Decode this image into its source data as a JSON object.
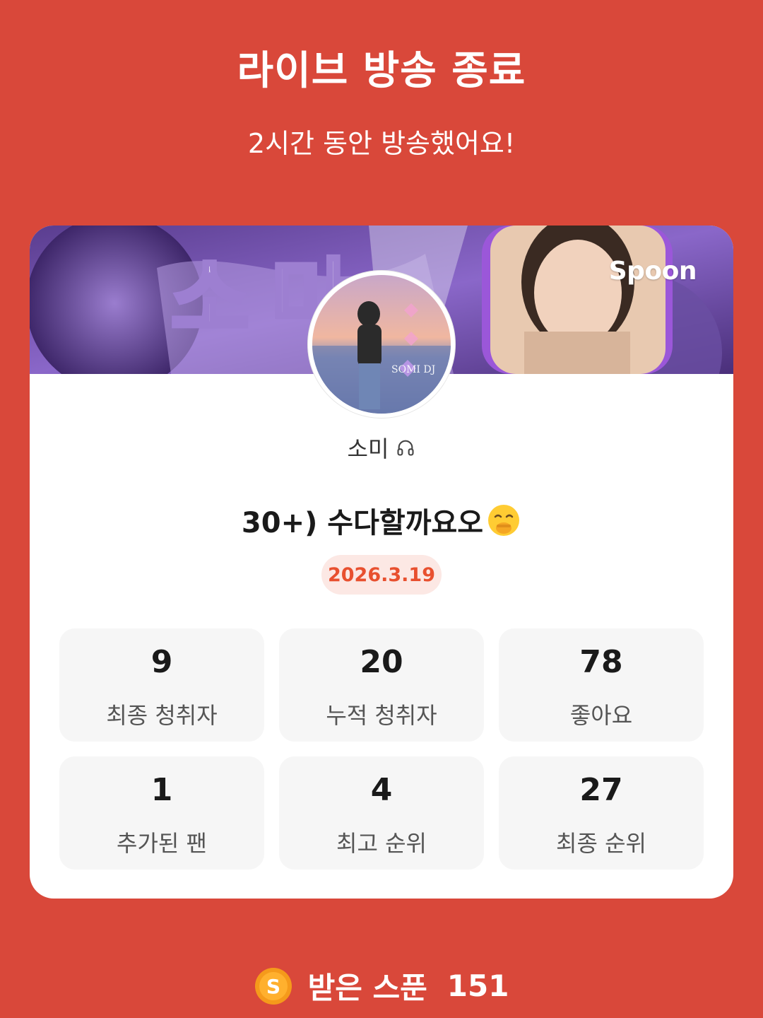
{
  "header": {
    "title": "라이브 방송 종료",
    "subtitle": "2시간 동안 방송했어요!"
  },
  "card": {
    "banner_brand": "Spoon",
    "dj_name": "소미",
    "live_title": "30+) 수다할까요오",
    "date": "2026.3.19",
    "stats": [
      {
        "value": "9",
        "label": "최종 청취자"
      },
      {
        "value": "20",
        "label": "누적 청취자"
      },
      {
        "value": "78",
        "label": "좋아요"
      },
      {
        "value": "1",
        "label": "추가된 팬"
      },
      {
        "value": "4",
        "label": "최고 순위"
      },
      {
        "value": "27",
        "label": "최종 순위"
      }
    ]
  },
  "footer": {
    "label": "받은 스푼",
    "value": "151",
    "coin_letter": "S"
  },
  "colors": {
    "background": "#D9483A",
    "accent": "#E8502F",
    "badge_bg": "#FCE8E4",
    "stat_bg": "#F6F6F6"
  },
  "icons": [
    "headphone-icon",
    "hand-over-mouth-emoji",
    "spoon-coin-icon"
  ]
}
